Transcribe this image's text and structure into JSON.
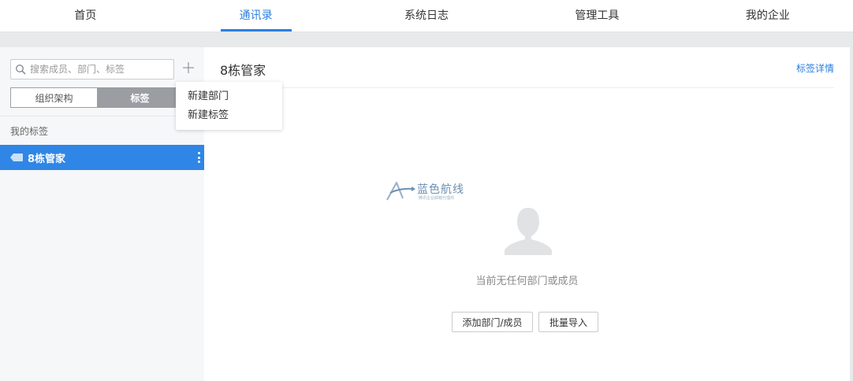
{
  "topnav": {
    "tabs": [
      {
        "label": "首页",
        "active": false
      },
      {
        "label": "通讯录",
        "active": true
      },
      {
        "label": "系统日志",
        "active": false
      },
      {
        "label": "管理工具",
        "active": false
      },
      {
        "label": "我的企业",
        "active": false
      }
    ]
  },
  "sidebar": {
    "search": {
      "placeholder": "搜索成员、部门、标签",
      "value": ""
    },
    "add_icon": "plus-icon",
    "segments": {
      "org": "组织架构",
      "tags": "标签",
      "selected": "标签"
    },
    "section_label": "我的标签",
    "tags": [
      {
        "label": "8栋管家",
        "selected": true
      }
    ]
  },
  "dropdown": {
    "items": [
      "新建部门",
      "新建标签"
    ]
  },
  "main": {
    "title": "8栋管家",
    "detail_link": "标签详情",
    "watermark": {
      "title": "蓝色航线",
      "subtitle": "腾讯企业邮箱代理商"
    },
    "empty_text": "当前无任何部门或成员",
    "buttons": {
      "add": "添加部门/成员",
      "import": "批量导入"
    }
  },
  "colors": {
    "accent": "#2b7fde",
    "selected_row": "#2f86e6",
    "segment_on": "#9a9da2"
  }
}
